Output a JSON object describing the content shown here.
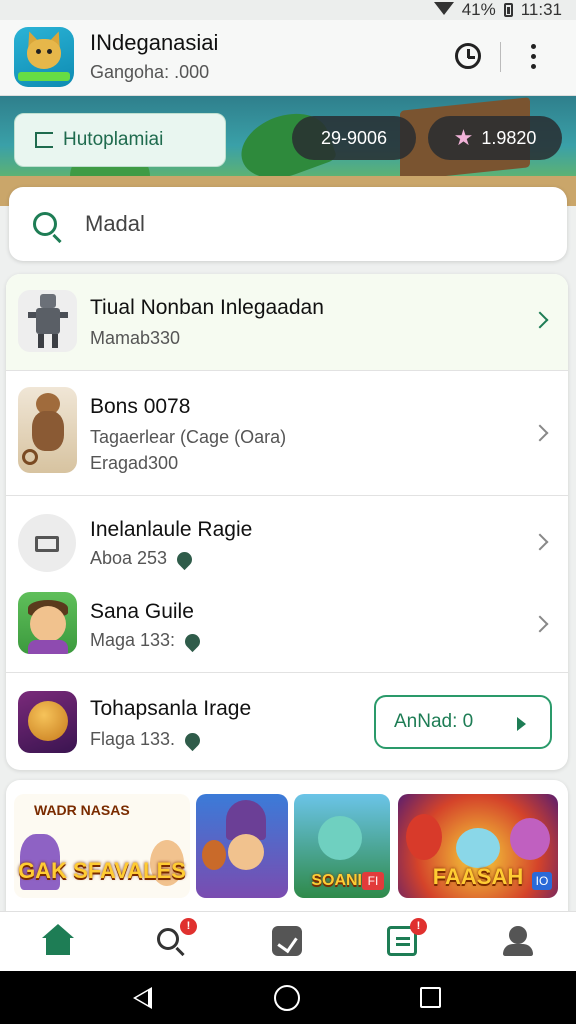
{
  "status_bar": {
    "battery": "41%",
    "time": "11:31"
  },
  "app_header": {
    "title": "INdeganasiai",
    "subtitle": "Gangoha: .000",
    "icons": [
      "alarm-clock-icon",
      "more-vert-icon"
    ]
  },
  "banner": {
    "primary_button": "Hutoplamiai",
    "chip_1": "29-9006",
    "chip_2": "1.9820",
    "chip_2_icon": "star-icon"
  },
  "search": {
    "value": "Madal"
  },
  "list": [
    {
      "title": "Tiual Nonban Inlegaadan",
      "sub": "Mamab330",
      "chevron": "green"
    },
    {
      "title": "Bons 0078",
      "sub": "Tagaerlear (Cage (Oara)",
      "sub2": "Eragad300",
      "chevron": "gray"
    },
    {
      "title": "Inelanlaule Ragie",
      "sub": "Aboa 253",
      "chevron": "gray"
    },
    {
      "title": "Sana Guile",
      "sub": "Maga 133:",
      "chevron": "gray"
    },
    {
      "title": "Tohapsanla Irage",
      "sub": "Flaga 133.",
      "button": "AnNad: 0"
    }
  ],
  "featured": {
    "tile_1_top": "WADR NASAS",
    "tile_1_caption": "GAK SFAVALES",
    "tile_3_caption": "SOANIS",
    "tile_3_tag": "FI",
    "tile_4_caption": "FAASAH",
    "tile_4_tag": "IO"
  },
  "bottom_nav": {
    "items": [
      "home-icon",
      "search-icon",
      "edit-icon",
      "document-icon",
      "profile-icon"
    ],
    "badges": {
      "search": "!",
      "document": "!"
    }
  },
  "colors": {
    "accent": "#1e7d55",
    "badge": "#e0312f"
  }
}
